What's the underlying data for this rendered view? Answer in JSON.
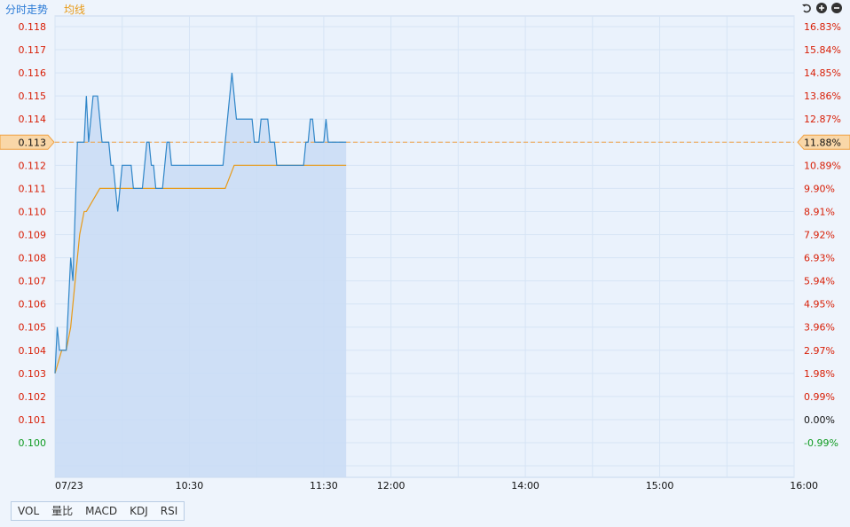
{
  "header": {
    "title": "分时走势",
    "avg_line_label": "均线",
    "controls": [
      "undo-icon",
      "zoom-in-icon",
      "zoom-out-icon"
    ]
  },
  "bottom_tabs": [
    "VOL",
    "量比",
    "MACD",
    "KDJ",
    "RSI"
  ],
  "colors": {
    "price_line": "#2f86c8",
    "avg_line": "#e89a17",
    "area_fill": "#c9dcf5",
    "up": "#d81e06",
    "down": "#0d9a1f",
    "neutral": "#111111",
    "grid": "#d6e4f5",
    "ref_line": "#f0a040",
    "ref_marker": "#f9d7a8"
  },
  "chart_data": {
    "type": "line",
    "title": "分时走势",
    "reference_price": 0.113,
    "reference_percent": "11.88%",
    "y_ticks": [
      "0.118",
      "0.117",
      "0.116",
      "0.115",
      "0.114",
      "0.113",
      "0.112",
      "0.111",
      "0.110",
      "0.109",
      "0.108",
      "0.107",
      "0.106",
      "0.105",
      "0.104",
      "0.103",
      "0.102",
      "0.101",
      "0.100"
    ],
    "y_right_ticks": [
      "16.83%",
      "15.84%",
      "14.85%",
      "13.86%",
      "12.87%",
      "11.88%",
      "10.89%",
      "9.90%",
      "8.91%",
      "7.92%",
      "6.93%",
      "5.94%",
      "4.95%",
      "3.96%",
      "2.97%",
      "1.98%",
      "0.99%",
      "0.00%",
      "-0.99%"
    ],
    "y_range": [
      0.099,
      0.1185
    ],
    "x_labels": [
      "07/23",
      "10:30",
      "11:30",
      "12:00",
      "14:00",
      "15:00",
      "16:00"
    ],
    "x_range_minutes": [
      0,
      330
    ],
    "series": [
      {
        "name": "分时走势",
        "x": [
          0,
          1,
          2,
          3,
          4,
          5,
          6,
          7,
          8,
          9,
          10,
          11,
          12,
          13,
          14,
          15,
          16,
          17,
          18,
          19,
          20,
          21,
          22,
          23,
          24,
          25,
          26,
          27,
          28,
          29,
          30,
          31,
          32,
          33,
          34,
          35,
          36,
          37,
          38,
          39,
          40,
          41,
          42,
          43,
          44,
          45,
          46,
          47,
          48,
          49,
          50,
          51,
          52,
          53,
          54,
          55,
          56,
          57,
          58,
          59,
          60,
          61,
          62,
          63,
          64,
          65,
          66,
          67,
          68,
          69,
          70,
          71,
          72,
          73,
          74,
          75,
          76,
          77,
          78,
          79,
          80,
          81,
          82,
          83,
          84,
          85,
          86,
          87,
          88,
          89,
          90,
          91,
          92,
          93,
          94,
          95,
          96,
          97,
          98,
          99,
          100,
          101,
          102,
          103,
          104,
          105,
          106,
          107,
          108,
          109,
          110,
          111,
          112,
          113,
          114,
          115,
          116,
          117,
          118,
          119,
          120,
          121,
          122,
          123,
          124,
          125,
          126,
          127,
          128,
          129,
          130
        ],
        "values": [
          0.103,
          0.105,
          0.104,
          0.104,
          0.104,
          0.104,
          0.106,
          0.108,
          0.107,
          0.11,
          0.113,
          0.113,
          0.113,
          0.113,
          0.115,
          0.113,
          0.114,
          0.115,
          0.115,
          0.115,
          0.114,
          0.113,
          0.113,
          0.113,
          0.113,
          0.112,
          0.112,
          0.111,
          0.11,
          0.111,
          0.112,
          0.112,
          0.112,
          0.112,
          0.112,
          0.111,
          0.111,
          0.111,
          0.111,
          0.111,
          0.112,
          0.113,
          0.113,
          0.112,
          0.112,
          0.111,
          0.111,
          0.111,
          0.111,
          0.112,
          0.113,
          0.113,
          0.112,
          0.112,
          0.112,
          0.112,
          0.112,
          0.112,
          0.112,
          0.112,
          0.112,
          0.112,
          0.112,
          0.112,
          0.112,
          0.112,
          0.112,
          0.112,
          0.112,
          0.112,
          0.112,
          0.112,
          0.112,
          0.112,
          0.112,
          0.112,
          0.113,
          0.114,
          0.115,
          0.116,
          0.115,
          0.114,
          0.114,
          0.114,
          0.114,
          0.114,
          0.114,
          0.114,
          0.114,
          0.113,
          0.113,
          0.113,
          0.114,
          0.114,
          0.114,
          0.114,
          0.113,
          0.113,
          0.113,
          0.112,
          0.112,
          0.112,
          0.112,
          0.112,
          0.112,
          0.112,
          0.112,
          0.112,
          0.112,
          0.112,
          0.112,
          0.112,
          0.113,
          0.113,
          0.114,
          0.114,
          0.113,
          0.113,
          0.113,
          0.113,
          0.113,
          0.114,
          0.113,
          0.113,
          0.113,
          0.113,
          0.113,
          0.113,
          0.113,
          0.113,
          0.113
        ]
      },
      {
        "name": "均线",
        "x": [
          0,
          3,
          5,
          7,
          8,
          9,
          10,
          11,
          12,
          13,
          14,
          17,
          20,
          23,
          26,
          29,
          35,
          40,
          50,
          60,
          70,
          76,
          80,
          90,
          100,
          110,
          120,
          130
        ],
        "values": [
          0.103,
          0.104,
          0.104,
          0.105,
          0.106,
          0.107,
          0.108,
          0.109,
          0.1095,
          0.11,
          0.11,
          0.1105,
          0.111,
          0.111,
          0.111,
          0.111,
          0.111,
          0.111,
          0.111,
          0.111,
          0.111,
          0.111,
          0.112,
          0.112,
          0.112,
          0.112,
          0.112,
          0.112
        ]
      }
    ],
    "grid": true
  }
}
